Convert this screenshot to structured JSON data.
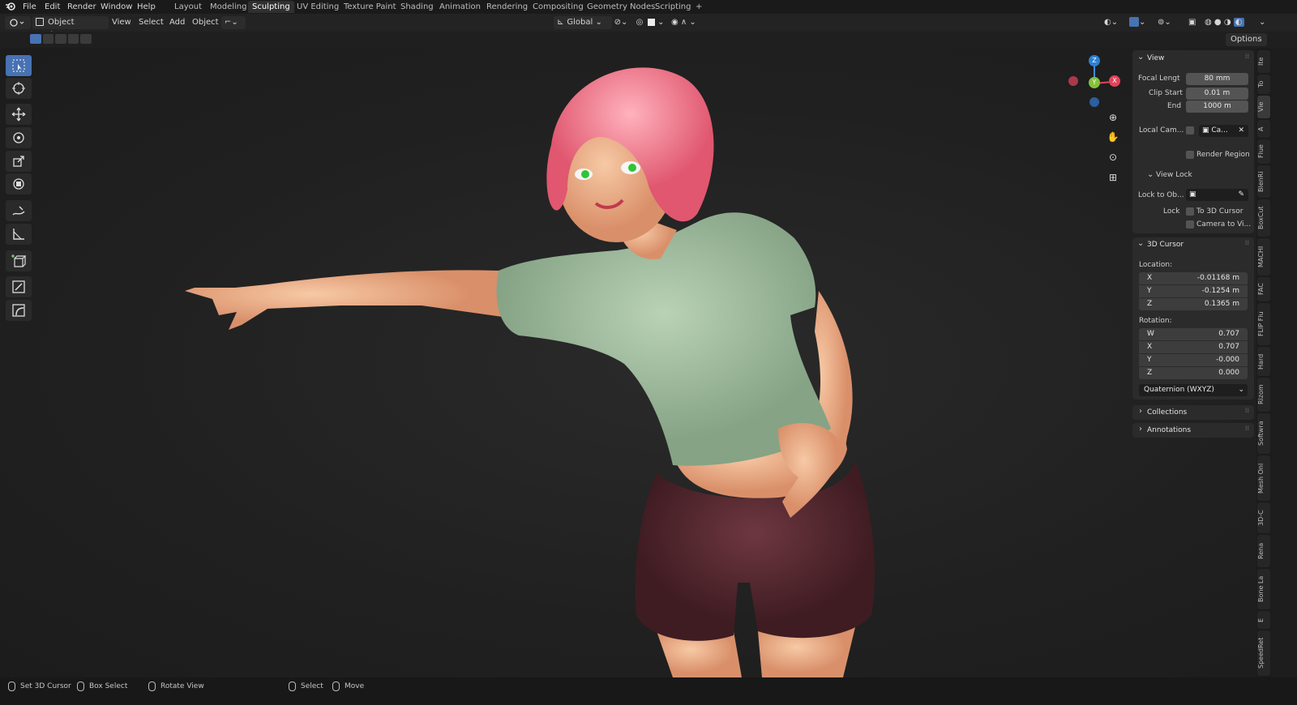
{
  "topbar": {
    "menus": [
      "File",
      "Edit",
      "Render",
      "Window",
      "Help"
    ],
    "workspaces": [
      "Layout",
      "Modeling",
      "Sculpting",
      "UV Editing",
      "Texture Paint",
      "Shading",
      "Animation",
      "Rendering",
      "Compositing",
      "Geometry Nodes",
      "Scripting",
      "+"
    ],
    "active_workspace": "Sculpting"
  },
  "header": {
    "mode": "Object Mode",
    "menus": [
      "View",
      "Select",
      "Add",
      "Object"
    ],
    "orientation": "Global",
    "options": "Options"
  },
  "npanel": {
    "view": {
      "title": "View",
      "focal_label": "Focal Lengt",
      "focal_value": "80 mm",
      "clip_start_label": "Clip Start",
      "clip_start_value": "0.01 m",
      "end_label": "End",
      "end_value": "1000 m",
      "local_cam_label": "Local Cam...",
      "local_cam_value": "Ca...",
      "render_region": "Render Region",
      "view_lock": "View Lock",
      "lock_to_obj": "Lock to Ob...",
      "lock_label": "Lock",
      "to_3d_cursor": "To 3D Cursor",
      "camera_to_view": "Camera to Vi..."
    },
    "cursor": {
      "title": "3D Cursor",
      "location_label": "Location:",
      "loc_x_k": "X",
      "loc_x": "-0.01168 m",
      "loc_y_k": "Y",
      "loc_y": "-0.1254 m",
      "loc_z_k": "Z",
      "loc_z": "0.1365 m",
      "rotation_label": "Rotation:",
      "rot_w_k": "W",
      "rot_w": "0.707",
      "rot_x_k": "X",
      "rot_x": "0.707",
      "rot_y_k": "Y",
      "rot_y": "-0.000",
      "rot_z_k": "Z",
      "rot_z": "0.000",
      "rotation_mode": "Quaternion (WXYZ)"
    },
    "collections": "Collections",
    "annotations": "Annotations"
  },
  "sidetabs": [
    "Ite",
    "To",
    "Vie",
    "A",
    "Flue",
    "BlenRi",
    "BoxCut",
    "MACHI",
    "FAC",
    "FLIP Flu",
    "Hard",
    "Rizom",
    "Softwra",
    "Mesh Onl",
    "3D-C",
    "Rena",
    "Bone La",
    "E",
    "SpeedRet"
  ],
  "gizmo": {
    "z": "Z",
    "y": "Y",
    "x": "X"
  },
  "status": {
    "set_cursor": "Set 3D Cursor",
    "box_select": "Box Select",
    "rotate_view": "Rotate View",
    "select": "Select",
    "move": "Move"
  },
  "colors": {
    "accent": "#4772b3",
    "hair": "#f08a9c",
    "shirt": "#a8c4a6",
    "shorts": "#5e2d33",
    "skin": "#f1b892"
  }
}
